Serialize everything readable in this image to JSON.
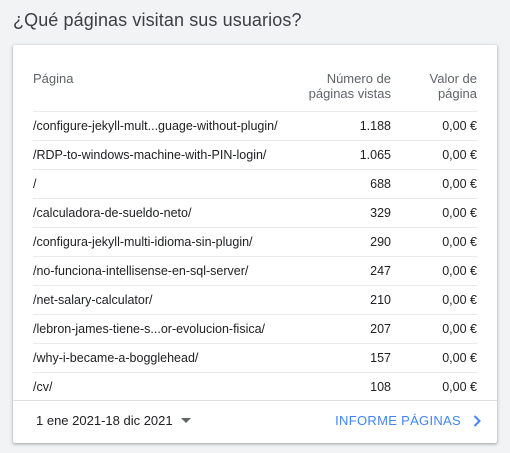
{
  "title": "¿Qué páginas visitan sus usuarios?",
  "table": {
    "headers": {
      "page": "Página",
      "views": "Número de páginas vistas",
      "value": "Valor de página"
    },
    "rows": [
      {
        "page": "/configure-jekyll-mult...guage-without-plugin/",
        "views": "1.188",
        "value": "0,00 €"
      },
      {
        "page": "/RDP-to-windows-machine-with-PIN-login/",
        "views": "1.065",
        "value": "0,00 €"
      },
      {
        "page": "/",
        "views": "688",
        "value": "0,00 €"
      },
      {
        "page": "/calculadora-de-sueldo-neto/",
        "views": "329",
        "value": "0,00 €"
      },
      {
        "page": "/configura-jekyll-multi-idioma-sin-plugin/",
        "views": "290",
        "value": "0,00 €"
      },
      {
        "page": "/no-funciona-intellisense-en-sql-server/",
        "views": "247",
        "value": "0,00 €"
      },
      {
        "page": "/net-salary-calculator/",
        "views": "210",
        "value": "0,00 €"
      },
      {
        "page": "/lebron-james-tiene-s...or-evolucion-fisica/",
        "views": "207",
        "value": "0,00 €"
      },
      {
        "page": "/why-i-became-a-bogglehead/",
        "views": "157",
        "value": "0,00 €"
      },
      {
        "page": "/cv/",
        "views": "108",
        "value": "0,00 €"
      }
    ]
  },
  "footer": {
    "date_range": "1 ene 2021-18 dic 2021",
    "report_link": "INFORME PÁGINAS",
    "accent_color": "#4285f4"
  },
  "icons": {
    "dropdown": "caret-down-icon",
    "link_arrow": "chevron-right-icon"
  }
}
